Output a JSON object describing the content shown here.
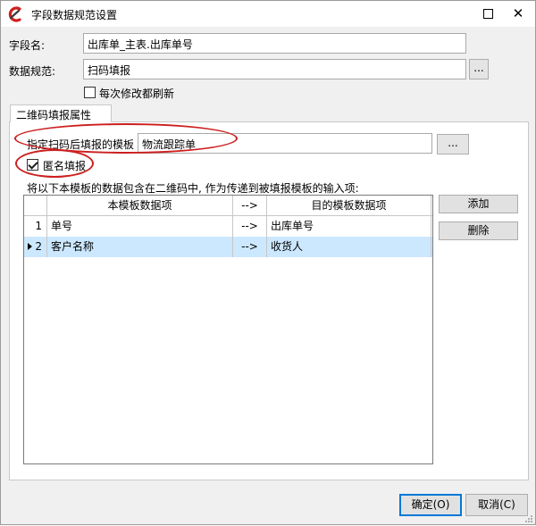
{
  "window": {
    "title": "字段数据规范设置",
    "maximize_icon": "maximize-icon",
    "close_glyph": "✕"
  },
  "fields": {
    "field_name_label": "字段名:",
    "field_name_value": "出库单_主表.出库单号",
    "data_spec_label": "数据规范:",
    "data_spec_value": "扫码填报",
    "browse_label": "...",
    "refresh_label": "每次修改都刷新",
    "refresh_checked": false
  },
  "tab": {
    "label": "二维码填报属性"
  },
  "qr": {
    "template_label": "指定扫码后填报的模板",
    "template_value": "物流跟踪单",
    "browse_label": "...",
    "anonymous_label": "匿名填报",
    "anonymous_checked": true,
    "description": "将以下本模板的数据包含在二维码中, 作为传递到被填报模板的输入项:"
  },
  "grid": {
    "columns": [
      "本模板数据项",
      "-->",
      "目的模板数据项"
    ],
    "rows": [
      {
        "index": "1",
        "source": "单号",
        "arrow": "-->",
        "target": "出库单号",
        "selected": false
      },
      {
        "index": "2",
        "source": "客户名称",
        "arrow": "-->",
        "target": "收货人",
        "selected": true
      }
    ]
  },
  "actions": {
    "add": "添加",
    "delete": "删除",
    "ok": "确定(O)",
    "cancel": "取消(C)"
  },
  "colors": {
    "annotation": "#cc1f1f",
    "selected_row": "#cce8ff",
    "primary_border": "#0078d7"
  }
}
